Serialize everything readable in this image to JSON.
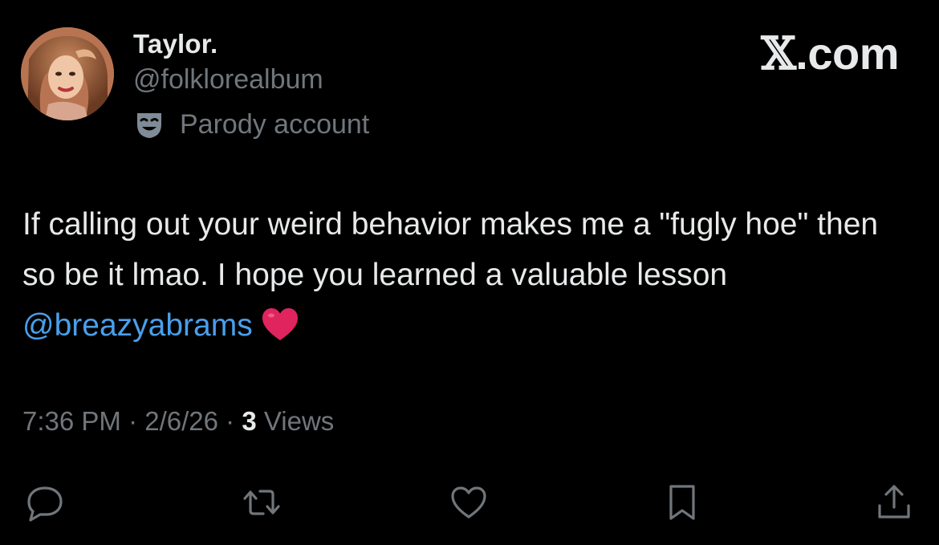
{
  "author": {
    "display_name": "Taylor.",
    "handle": "@folklorealbum",
    "badge_label": "Parody account",
    "badge_icon": "parody-mask-icon",
    "avatar": "profile-photo"
  },
  "site": {
    "logo_mark": "𝕏",
    "logo_text": ".com"
  },
  "tweet": {
    "text_before_mention": "If calling out your weird behavior makes me a \"fugly hoe\" then so be it lmao. I hope you learned a valuable lesson ",
    "mention": "@breazyabrams",
    "emoji": "red-heart-emoji"
  },
  "meta": {
    "time": "7:36 PM",
    "separator": "·",
    "date": "2/6/26",
    "views_count": "3",
    "views_label": "Views"
  },
  "actions": {
    "reply_icon": "reply-icon",
    "repost_icon": "repost-icon",
    "like_icon": "like-icon",
    "bookmark_icon": "bookmark-icon",
    "share_icon": "share-icon"
  },
  "colors": {
    "background": "#000000",
    "primary_text": "#e7e9ea",
    "secondary_text": "#71767b",
    "mention": "#4a9fea",
    "heart": "#e0245e"
  }
}
